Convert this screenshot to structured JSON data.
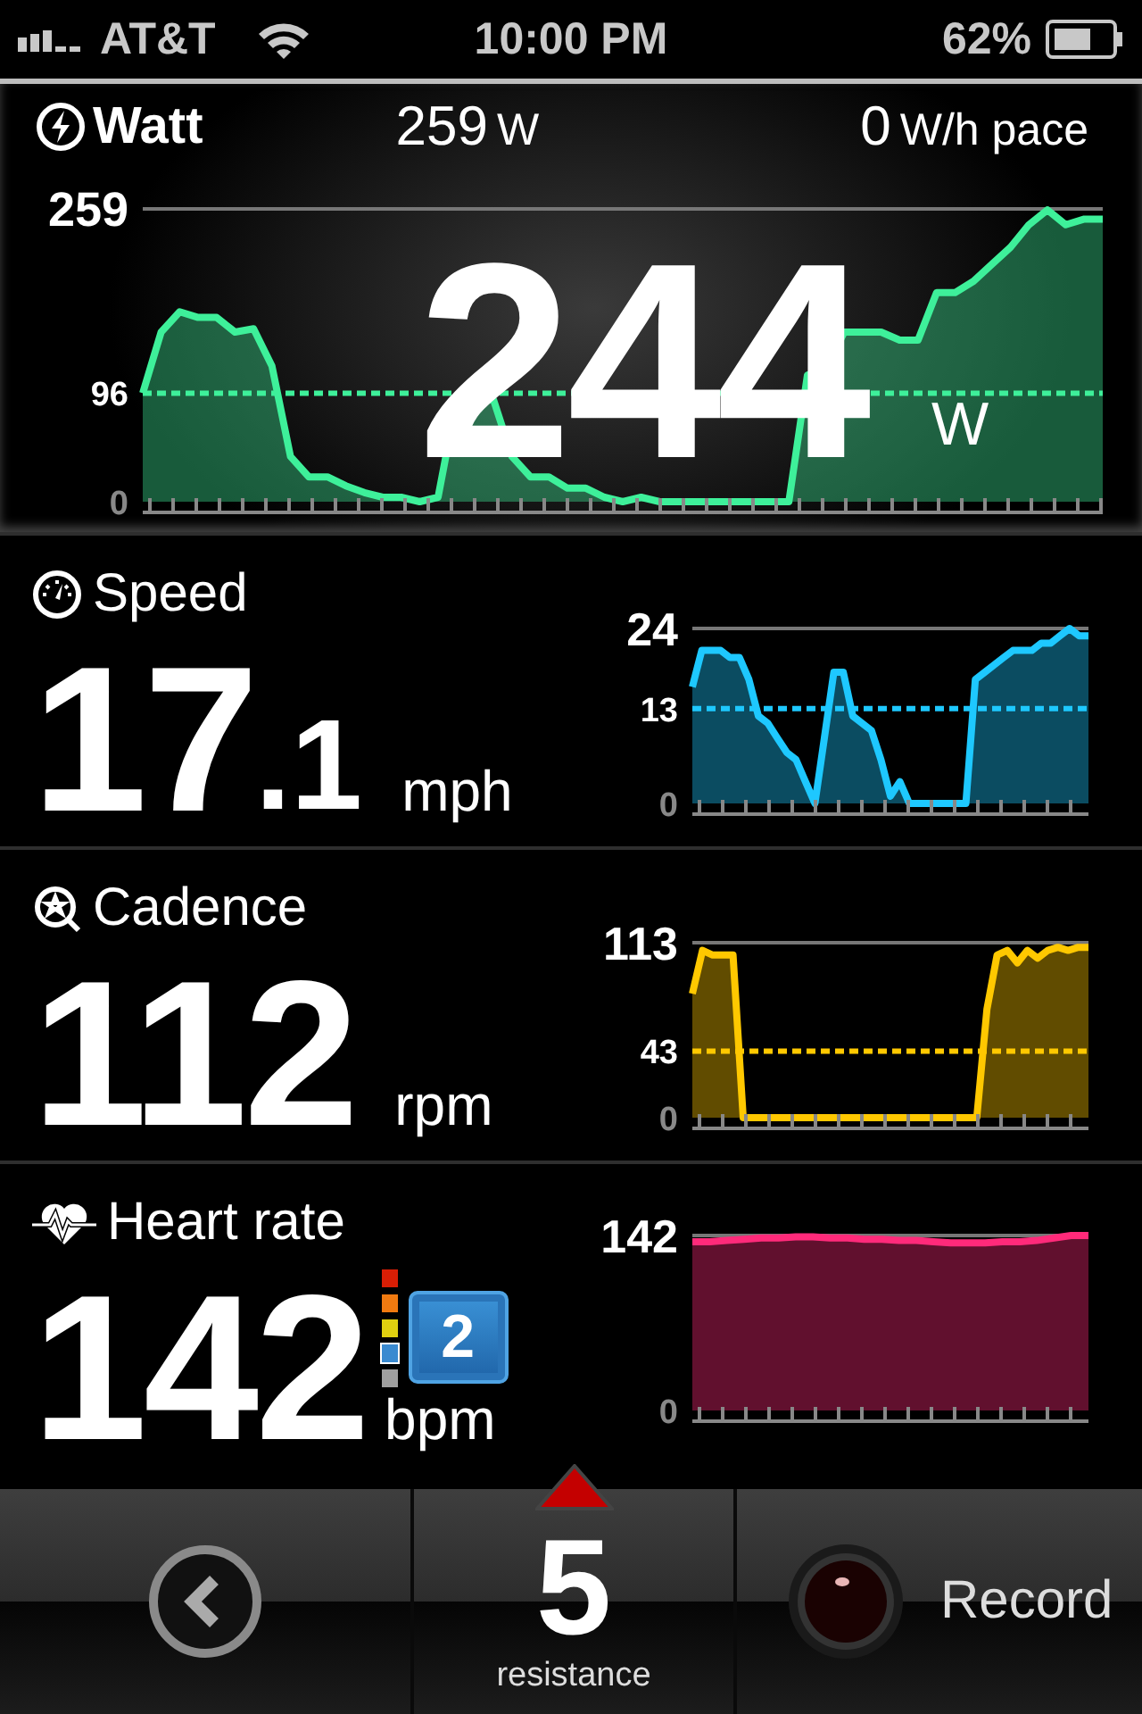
{
  "status_bar": {
    "carrier": "AT&T",
    "time": "10:00 PM",
    "battery": "62%"
  },
  "watt": {
    "title": "Watt",
    "average": "259",
    "average_unit": "W",
    "pace": "0",
    "pace_unit": "W/h pace",
    "current": "244",
    "current_unit": "W",
    "chart_data": {
      "type": "area",
      "ylim": [
        0,
        259
      ],
      "yticks": [
        0,
        96,
        259
      ],
      "ref_lines": [
        {
          "axis": "y",
          "value": 96
        }
      ],
      "series": [
        {
          "color": "#3ef09a",
          "values": [
            96,
            150,
            168,
            163,
            163,
            150,
            153,
            120,
            40,
            22,
            22,
            14,
            8,
            4,
            4,
            0,
            4,
            90,
            90,
            90,
            40,
            22,
            22,
            12,
            12,
            4,
            0,
            4,
            0,
            0,
            0,
            0,
            0,
            0,
            0,
            0,
            112,
            118,
            150,
            150,
            150,
            143,
            143,
            185,
            185,
            195,
            210,
            225,
            245,
            258,
            245,
            250,
            250
          ]
        }
      ]
    }
  },
  "metrics": [
    {
      "kind": "speed",
      "title": "Speed",
      "value": "17",
      "fraction": ".1",
      "unit": "mph",
      "chart_data": {
        "type": "area",
        "ylim": [
          0,
          24
        ],
        "yticks": [
          0,
          13,
          24
        ],
        "ref_lines": [
          {
            "axis": "y",
            "value": 13
          }
        ],
        "series": [
          {
            "color": "#1ec8ff",
            "values": [
              16,
              21,
              21,
              21,
              20,
              20,
              17,
              12,
              11,
              9,
              7,
              6,
              3,
              0,
              9,
              18,
              18,
              12,
              11,
              10,
              6,
              1,
              3,
              0,
              0,
              0,
              0,
              0,
              0,
              0,
              17,
              18,
              19,
              20,
              21,
              21,
              21,
              22,
              22,
              23,
              24,
              23,
              23
            ]
          }
        ]
      }
    },
    {
      "kind": "cadence",
      "title": "Cadence",
      "value": "112",
      "unit": "rpm",
      "chart_data": {
        "type": "area",
        "ylim": [
          0,
          113
        ],
        "yticks": [
          0,
          43,
          113
        ],
        "ref_lines": [
          {
            "axis": "y",
            "value": 43
          }
        ],
        "series": [
          {
            "color": "#ffc800",
            "values": [
              80,
              108,
              105,
              105,
              105,
              0,
              0,
              0,
              0,
              0,
              0,
              0,
              0,
              0,
              0,
              0,
              0,
              0,
              0,
              0,
              0,
              0,
              0,
              0,
              0,
              0,
              0,
              0,
              0,
              70,
              105,
              108,
              100,
              108,
              103,
              108,
              110,
              108,
              110,
              110
            ]
          }
        ]
      }
    },
    {
      "kind": "heart_rate",
      "title": "Heart rate",
      "value": "142",
      "unit": "bpm",
      "zone": "2",
      "zones": [
        {
          "color": "#d81e05",
          "selected": false
        },
        {
          "color": "#f07a10",
          "selected": false
        },
        {
          "color": "#e0d010",
          "selected": false
        },
        {
          "color": "#3a8ad0",
          "selected": true
        },
        {
          "color": "#a0a0a0",
          "selected": false
        }
      ],
      "chart_data": {
        "type": "area",
        "ylim": [
          0,
          142
        ],
        "yticks": [
          0,
          142
        ],
        "series": [
          {
            "color": "#ff2a7a",
            "values": [
              137,
              137,
              138,
              139,
              140,
              140,
              141,
              141,
              140,
              140,
              139,
              139,
              138,
              138,
              137,
              136,
              136,
              136,
              137,
              137,
              138,
              140,
              142,
              142
            ]
          }
        ]
      }
    }
  ],
  "bottom_bar": {
    "resistance": "5",
    "resistance_label": "resistance",
    "record_label": "Record"
  }
}
